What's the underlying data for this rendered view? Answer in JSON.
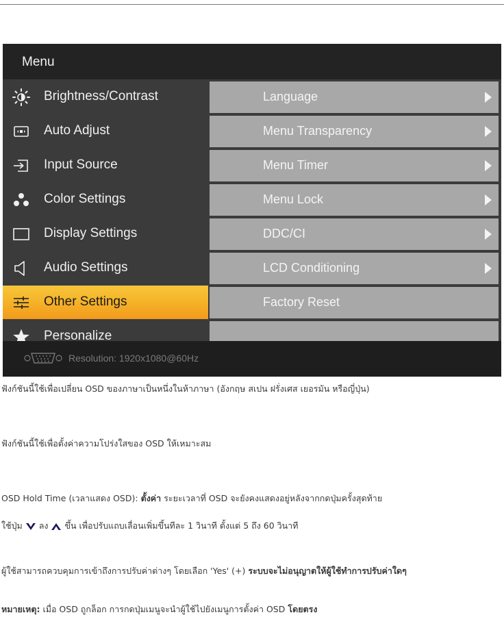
{
  "osd": {
    "title": "Menu",
    "left_items": [
      {
        "label": "Brightness/Contrast",
        "icon": "brightness-icon"
      },
      {
        "label": "Auto Adjust",
        "icon": "auto-adjust-icon"
      },
      {
        "label": "Input Source",
        "icon": "input-source-icon"
      },
      {
        "label": "Color Settings",
        "icon": "color-settings-icon"
      },
      {
        "label": "Display Settings",
        "icon": "display-settings-icon"
      },
      {
        "label": "Audio Settings",
        "icon": "speaker-icon"
      },
      {
        "label": "Other Settings",
        "icon": "sliders-icon",
        "active": true
      },
      {
        "label": "Personalize",
        "icon": "star-icon"
      }
    ],
    "right_items": [
      {
        "label": "Language",
        "has_arrow": true
      },
      {
        "label": "Menu Transparency",
        "has_arrow": true
      },
      {
        "label": "Menu Timer",
        "has_arrow": true
      },
      {
        "label": "Menu Lock",
        "has_arrow": true
      },
      {
        "label": "DDC/CI",
        "has_arrow": true
      },
      {
        "label": "LCD Conditioning",
        "has_arrow": true
      },
      {
        "label": "Factory Reset",
        "has_arrow": false
      }
    ],
    "footer": {
      "resolution": "Resolution:  1920x1080@60Hz"
    },
    "colors": {
      "header": "#232323",
      "panel": "#3b3b3b",
      "right_item": "#a8a8a8",
      "active_top": "#f6c53a",
      "active_bottom": "#f39a1c"
    }
  },
  "body": {
    "line1": "ฟังก์ชันนี้ใช้เพื่อเปลี่ยน OSD ของภาษาเป็นหนึ่งในห้าภาษา (อังกฤษ สเปน ฝรั่งเศส เยอรมัน หรือญี่ปุ่น)",
    "line2": "ฟังก์ชันนี้ใช้เพื่อตั้งค่าความโปร่งใสของ OSD ให้เหมาะสม",
    "line3_prefix": "OSD Hold Time (เวลาแสดง OSD):",
    "line3_bold": "ตั้งค่า",
    "line3_rest": "ระยะเวลาที่ OSD จะยังคงแสดงอยู่หลังจากกดปุ่มครั้งสุดท้าย",
    "line4_prefix": "ใช้ปุ่ม",
    "line4_down": "ลง",
    "line4_up": "ขึ้น",
    "line4_rest": "เพื่อปรับแถบเลื่อนเพิ่มขึ้นทีละ 1 วินาที ตั้งแต่ 5 ถึง 60 วินาที",
    "line5_rest": "ผู้ใช้สามารถควบคุมการเข้าถึงการปรับค่าต่างๆ โดยเลือก 'Yes' (+)",
    "line5_bold": "ระบบจะไม่อนุญาตให้ผู้ใช้ทำการปรับค่าใดๆ",
    "note_label": "หมายเหตุ:",
    "note_rest": "เมื่อ OSD ถูกล็อก การกดปุ่มเมนูจะนำผู้ใช้ไปยังเมนูการตั้งค่า OSD",
    "note_bold": "โดยตรง"
  }
}
